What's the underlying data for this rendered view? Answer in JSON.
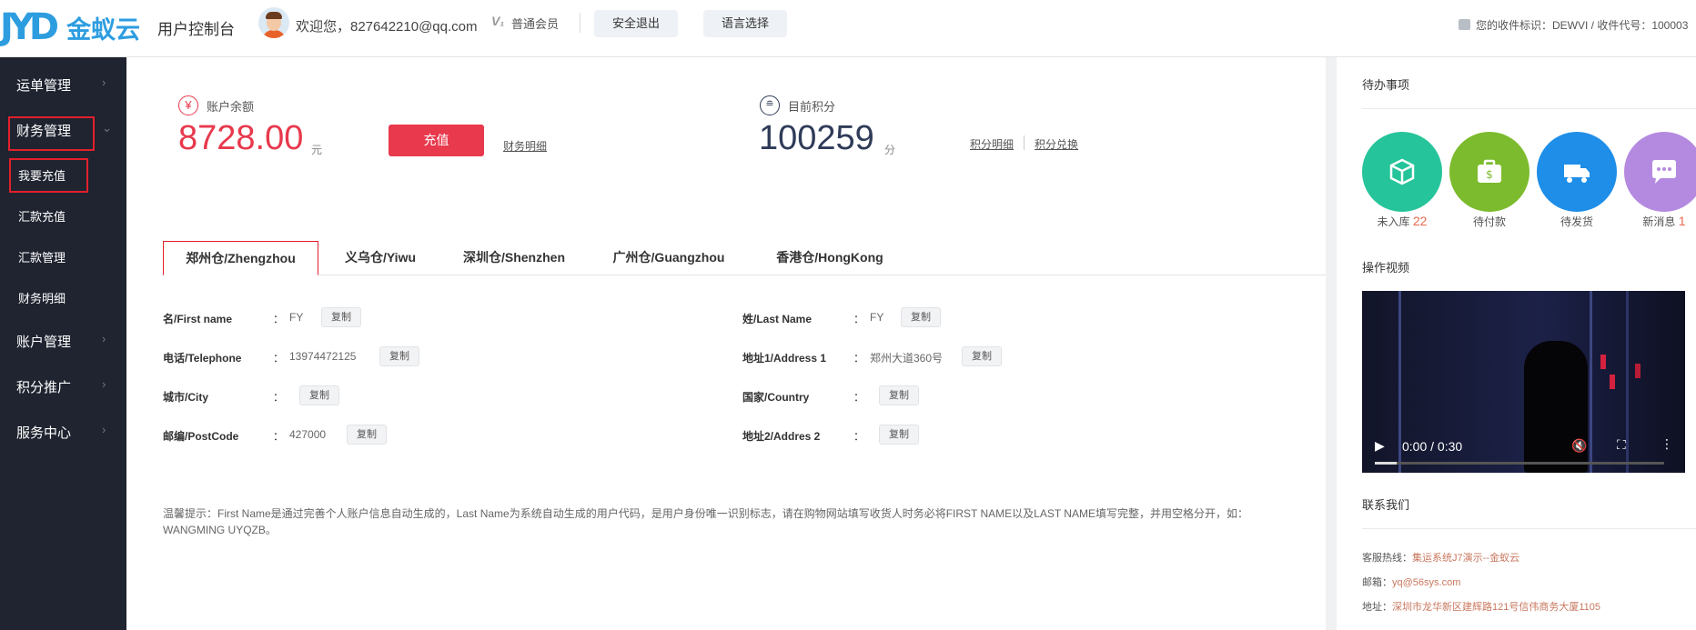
{
  "header": {
    "logo_mark": "JYD",
    "logo_text": "金蚁云",
    "console_title": "用户控制台",
    "welcome": "欢迎您，827642210@qq.com",
    "vip_icon": "V₁",
    "member_level": "普通会员",
    "logout_label": "安全退出",
    "language_label": "语言选择",
    "receive_info": "您的收件标识：DEWVI / 收件代号：100003"
  },
  "sidebar": {
    "items": [
      {
        "label": "运单管理"
      },
      {
        "label": "财务管理"
      },
      {
        "label": "账户管理"
      },
      {
        "label": "积分推广"
      },
      {
        "label": "服务中心"
      }
    ],
    "finance_sub": [
      {
        "label": "我要充值"
      },
      {
        "label": "汇款充值"
      },
      {
        "label": "汇款管理"
      },
      {
        "label": "财务明细"
      }
    ]
  },
  "balance": {
    "icon": "¥",
    "label": "账户余额",
    "value": "8728.00",
    "unit": "元",
    "recharge_label": "充值",
    "detail_link": "财务明细"
  },
  "points": {
    "icon": "≘",
    "label": "目前积分",
    "value": "100259",
    "unit": "分",
    "detail_link": "积分明细",
    "exchange_link": "积分兑换"
  },
  "tabs": [
    {
      "label": "郑州仓/Zhengzhou",
      "active": true
    },
    {
      "label": "义乌仓/Yiwu"
    },
    {
      "label": "深圳仓/Shenzhen"
    },
    {
      "label": "广州仓/Guangzhou"
    },
    {
      "label": "香港仓/HongKong"
    }
  ],
  "address_form": {
    "colon": "：",
    "copy_label": "复制",
    "first_name": {
      "label": "名/First name",
      "value": "FY"
    },
    "last_name": {
      "label": "姓/Last Name",
      "value": "FY"
    },
    "telephone": {
      "label": "电话/Telephone",
      "value": "13974472125"
    },
    "address1": {
      "label": "地址1/Address 1",
      "value": "郑州大道360号"
    },
    "city": {
      "label": "城市/City",
      "value": ""
    },
    "country": {
      "label": "国家/Country",
      "value": ""
    },
    "postcode": {
      "label": "邮编/PostCode",
      "value": "427000"
    },
    "address2": {
      "label": "地址2/Addres 2",
      "value": ""
    }
  },
  "tip": "温馨提示：First Name是通过完善个人账户信息自动生成的，Last Name为系统自动生成的用户代码，是用户身份唯一识别标志，请在购物网站填写收货人时务必将FIRST NAME以及LAST NAME填写完整，并用空格分开，如：WANGMING UYQZB。",
  "todo": {
    "title": "待办事项",
    "items": [
      {
        "label": "未入库",
        "count": "22",
        "color": "#26c49a"
      },
      {
        "label": "待付款",
        "count": "",
        "color": "#7cbb2d"
      },
      {
        "label": "待发货",
        "count": "",
        "color": "#1e8ee8"
      },
      {
        "label": "新消息",
        "count": "1",
        "color": "#b48ae0"
      }
    ]
  },
  "video": {
    "title": "操作视频",
    "time": "0:00 / 0:30"
  },
  "contact": {
    "title": "联系我们",
    "hotline_label": "客服热线：",
    "hotline_value": "集运系统J7演示--金蚁云",
    "email_label": "邮箱：",
    "email_value": "yq@56sys.com",
    "address_label": "地址：",
    "address_value": "深圳市龙华新区建辉路121号信伟商务大厦1105"
  },
  "colors": {
    "accent_red": "#e8394d",
    "sidebar_bg": "#1f2430",
    "highlight_border": "#e2202c",
    "points_navy": "#2f3b58"
  }
}
